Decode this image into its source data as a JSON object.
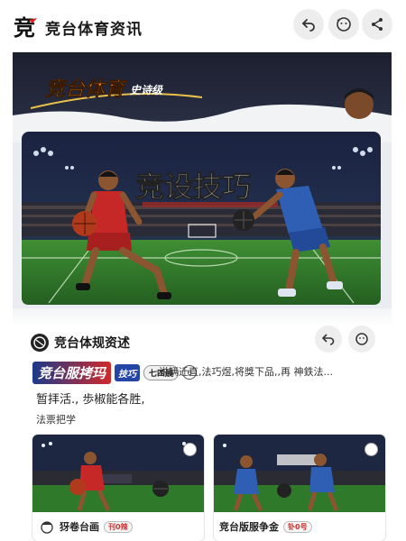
{
  "app": {
    "title": "竞台体育资讯",
    "logo": "竞"
  },
  "top_actions": [
    "back-icon",
    "face-icon",
    "share-icon"
  ],
  "hero": {
    "banner_title": "竞台体育",
    "banner_tag": "史诗级",
    "headline": "竞设技巧",
    "colors": {
      "banner_bg": "#1a1d2c",
      "jersey_red": "#c62828",
      "jersey_blue": "#2f5fb5",
      "grass": "#2f7a2a"
    }
  },
  "section": {
    "title": "竞台体规资述",
    "tag_main": "竞台服拷玛",
    "tag_sub": "技巧",
    "tag_badge": "七四展",
    "tag_dot": "6",
    "desc_line1": "说辆迁直,法巧煜,将獎下品,,再 神鉄法...",
    "desc_line2": "暂拝活., 歩椒能各胜,",
    "desc_line3": "法票把学"
  },
  "cards": [
    {
      "label": "犽卷台画",
      "badge": "刊0辣"
    },
    {
      "label": "竞台版服争金",
      "badge": "钋0号"
    }
  ]
}
